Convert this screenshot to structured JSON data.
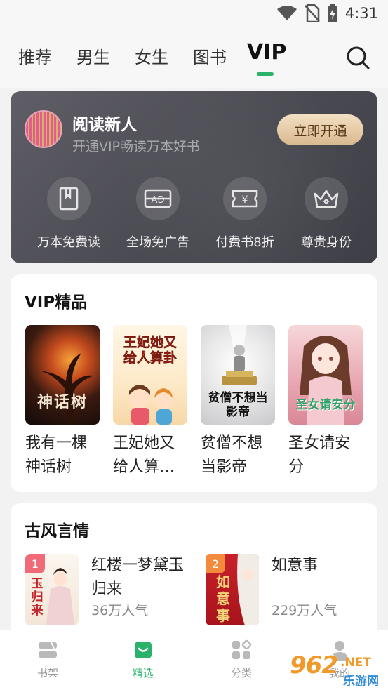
{
  "status_bar": {
    "time": "4:31",
    "icons": [
      "wifi-icon",
      "no-sim-icon",
      "battery-charging-icon"
    ]
  },
  "top_nav": {
    "tabs": [
      {
        "label": "推荐",
        "active": false
      },
      {
        "label": "男生",
        "active": false
      },
      {
        "label": "女生",
        "active": false
      },
      {
        "label": "图书",
        "active": false
      },
      {
        "label": "VIP",
        "active": true
      }
    ],
    "search_icon": "search-icon",
    "accent_color": "#2ab26a"
  },
  "vip_card": {
    "user_name": "阅读新人",
    "subtitle": "开通VIP畅读万本好书",
    "open_button": "立即开通",
    "perks": [
      {
        "label": "万本免费读",
        "icon": "book-icon"
      },
      {
        "label": "全场免广告",
        "icon": "ad-icon"
      },
      {
        "label": "付费书8折",
        "icon": "coupon-icon"
      },
      {
        "label": "尊贵身份",
        "icon": "crown-icon"
      }
    ]
  },
  "vip_section": {
    "title": "VIP精品",
    "books": [
      {
        "title": "我有一棵神话树",
        "cover_text": "神话树"
      },
      {
        "title": "王妃她又给人算…",
        "cover_text": "王妃她又给人算卦"
      },
      {
        "title": "贫僧不想当影帝",
        "cover_text": "贫僧不想当影帝"
      },
      {
        "title": "圣女请安分",
        "cover_text": "圣女请安分"
      }
    ]
  },
  "romance_section": {
    "title": "古风言情",
    "books": [
      {
        "rank": "1",
        "title": "红楼一梦黛玉归来",
        "popularity": "36万人气",
        "cover_text": "玉归来"
      },
      {
        "rank": "2",
        "title": "如意事",
        "popularity": "229万人气",
        "cover_text": "如意事"
      }
    ]
  },
  "bottom_nav": {
    "items": [
      {
        "label": "书架",
        "icon": "bookshelf-icon",
        "active": false
      },
      {
        "label": "精选",
        "icon": "featured-icon",
        "active": true
      },
      {
        "label": "分类",
        "icon": "category-icon",
        "active": false
      },
      {
        "label": "我的",
        "icon": "profile-icon",
        "active": false
      }
    ]
  },
  "watermark": {
    "main": "962",
    "net": ".NET",
    "sub": "乐游网"
  }
}
